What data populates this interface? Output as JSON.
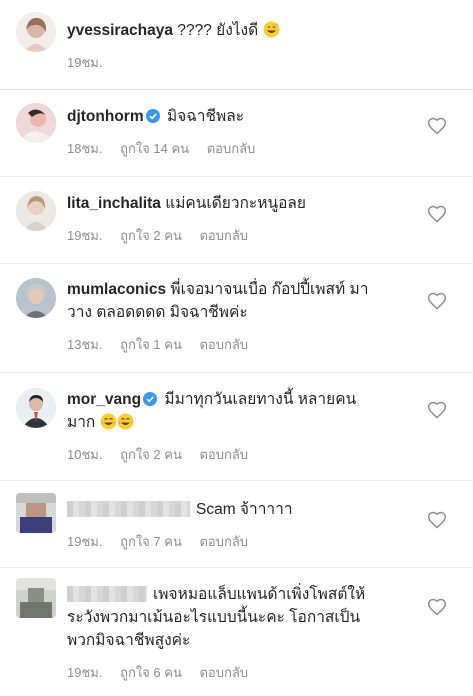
{
  "comments": [
    {
      "username": "yvessirachaya",
      "text": "???? ยังไงดี",
      "emoji": "grinning-sweat-emoji",
      "time": "19ชม.",
      "likes": "",
      "reply": "",
      "verified": false
    },
    {
      "username": "djtonhorm",
      "text": "มิจฉาชีพละ",
      "time": "18ชม.",
      "likes": "ถูกใจ 14 คน",
      "reply": "ตอบกลับ",
      "verified": true
    },
    {
      "username": "lita_inchalita",
      "text": "แม่คนเดียวกะหนูอลย",
      "time": "19ชม.",
      "likes": "ถูกใจ 2 คน",
      "reply": "ตอบกลับ",
      "verified": false
    },
    {
      "username": "mumlaconics",
      "text_line1": "พี่เจอมาจนเบื่อ ก๊อปปี้เพสท์ มา",
      "text_line2": "วาง ตลอดดดด มิจฉาชีพค่ะ",
      "time": "13ชม.",
      "likes": "ถูกใจ 1 คน",
      "reply": "ตอบกลับ",
      "verified": false
    },
    {
      "username": "mor_vang",
      "text_line1": "มีมาทุกวันเลยทางนี้ หลายคน",
      "text_line2": "มาก",
      "time": "10ชม.",
      "likes": "ถูกใจ 2 คน",
      "reply": "ตอบกลับ",
      "verified": true
    },
    {
      "username": "",
      "text": "Scam  จ้าาาาา",
      "time": "19ชม.",
      "likes": "ถูกใจ 7 คน",
      "reply": "ตอบกลับ",
      "verified": false
    },
    {
      "username": "",
      "text_line1": "เพจหมอแล็บแพนด้าเพิ่งโพสต์ให้",
      "text_line2": "ระวังพวกมาเม้นอะไรแบบนี้นะคะ โอกาสเป็น",
      "text_line3": "พวกมิจฉาชีพสูงค่ะ",
      "time": "19ชม.",
      "likes": "ถูกใจ 6 คน",
      "reply": "ตอบกลับ",
      "verified": false
    }
  ],
  "colors": {
    "text": "#262626",
    "meta": "#8e8e8e",
    "verified_blue": "#3897f0",
    "separator": "#e7e7e7"
  },
  "icons": {
    "like": "heart-outline-icon",
    "verified": "verified-badge-icon"
  }
}
